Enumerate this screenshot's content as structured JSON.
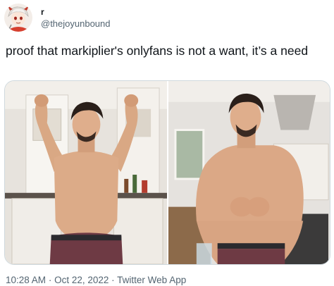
{
  "author": {
    "display_name": "r",
    "handle": "@thejoyunbound",
    "avatar_icon": "anime-character-avatar"
  },
  "tweet": {
    "text": "proof that markiplier's onlyfans is not a want, it’s a need"
  },
  "media": {
    "images": [
      {
        "subject": "shirtless man flexing both arms in a kitchen"
      },
      {
        "subject": "shirtless man with fists together in a kitchen"
      }
    ]
  },
  "meta": {
    "time": "10:28 AM",
    "separator": "·",
    "date": "Oct 22, 2022",
    "source": "Twitter Web App"
  },
  "colors": {
    "text_primary": "#0f1419",
    "text_secondary": "#536471",
    "border": "#cfd9de"
  }
}
